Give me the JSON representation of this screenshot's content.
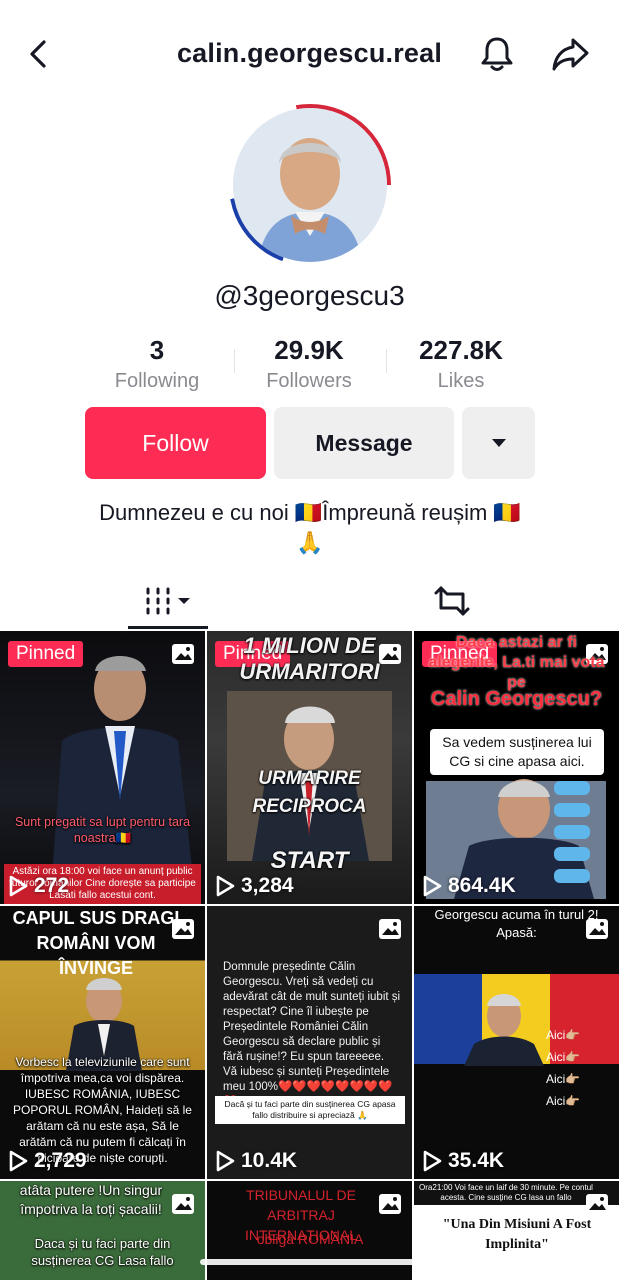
{
  "header": {
    "title": "calin.georgescu.real"
  },
  "profile": {
    "handle": "@3georgescu3",
    "stats": [
      {
        "value": "3",
        "label": "Following"
      },
      {
        "value": "29.9K",
        "label": "Followers"
      },
      {
        "value": "227.8K",
        "label": "Likes"
      }
    ],
    "bio_text": "Dumnezeu e cu noi 🇷🇴Împreună  reușim 🇷🇴",
    "bio_emoji": "🙏"
  },
  "actions": {
    "follow_label": "Follow",
    "message_label": "Message"
  },
  "colors": {
    "accent": "#fe2c55",
    "button_bg": "#efeff0",
    "muted_text": "#8a8b91"
  },
  "posts": [
    {
      "pinned": "Pinned",
      "views": "272",
      "caption": "Sunt pregatit sa lupt pentru tara noastra🇷🇴",
      "caption2": "Astăzi ora 18:00 voi face un anunț public tuturor românilor Cine dorește sa participe Lasati fallo acestui cont."
    },
    {
      "pinned": "Pinned",
      "views": "3,284",
      "top": "1 MILION DE URMARITORI",
      "mid": "URMARIRE RECIPROCA",
      "bot": "START"
    },
    {
      "pinned": "Pinned",
      "views": "864.4K",
      "top": "Daca astazi ar fi alegerile, La.ti mai vota pe",
      "name": "Calin Georgescu?",
      "box": "Sa vedem susținerea lui CG si cine apasa aici."
    },
    {
      "views": "2,729",
      "top": "CAPUL SUS DRAGI ROMÂNI VOM ÎNVINGE",
      "body": "Vorbesc la televiziunile care sunt împotriva mea,ca voi dispărea. IUBESC ROMÂNIA, IUBESC POPORUL ROMÂN, Haideți să le arătam că nu este așa, Să le arătăm că nu putem fi călcați în picioare de niște corupți."
    },
    {
      "views": "10.4K",
      "body": "Domnule președinte Călin Georgescu. Vreți să vedeți cu adevărat cât de mult sunteți iubit și respectat? Cine îl iubește pe Președintele României Călin Georgescu să declare public și fără rușine!? Eu spun tareeeee. Vă iubesc și sunteți Președintele meu 100%❤️❤️❤️❤️❤️❤️❤️❤️❤️",
      "note": "Dacă și tu faci parte din susținerea CG apasa fallo distribuire si apreciază 🙏"
    },
    {
      "views": "35.4K",
      "top": "Georgescu acuma în turul 2! Apasă:",
      "aici": [
        "Aici👉🏼",
        "Aici👉🏼",
        "Aici👉🏼",
        "Aici👉🏼"
      ]
    },
    {
      "top": "atâta putere !Un singur împotriva la toți șacalii!",
      "body": "Daca și tu faci parte din susținerea CG Lasa fallo"
    },
    {
      "top": "TRIBUNALUL DE ARBITRAJ INTERNAȚIONAL",
      "mid": "obligă ROMÂNIA"
    },
    {
      "top": "Ora21:00 Voi face un laif de 30 minute. Pe contul acesta. Cine susține CG lasa un fallo",
      "quote": "\"Una Din Misiuni A Fost Implinita\""
    }
  ]
}
